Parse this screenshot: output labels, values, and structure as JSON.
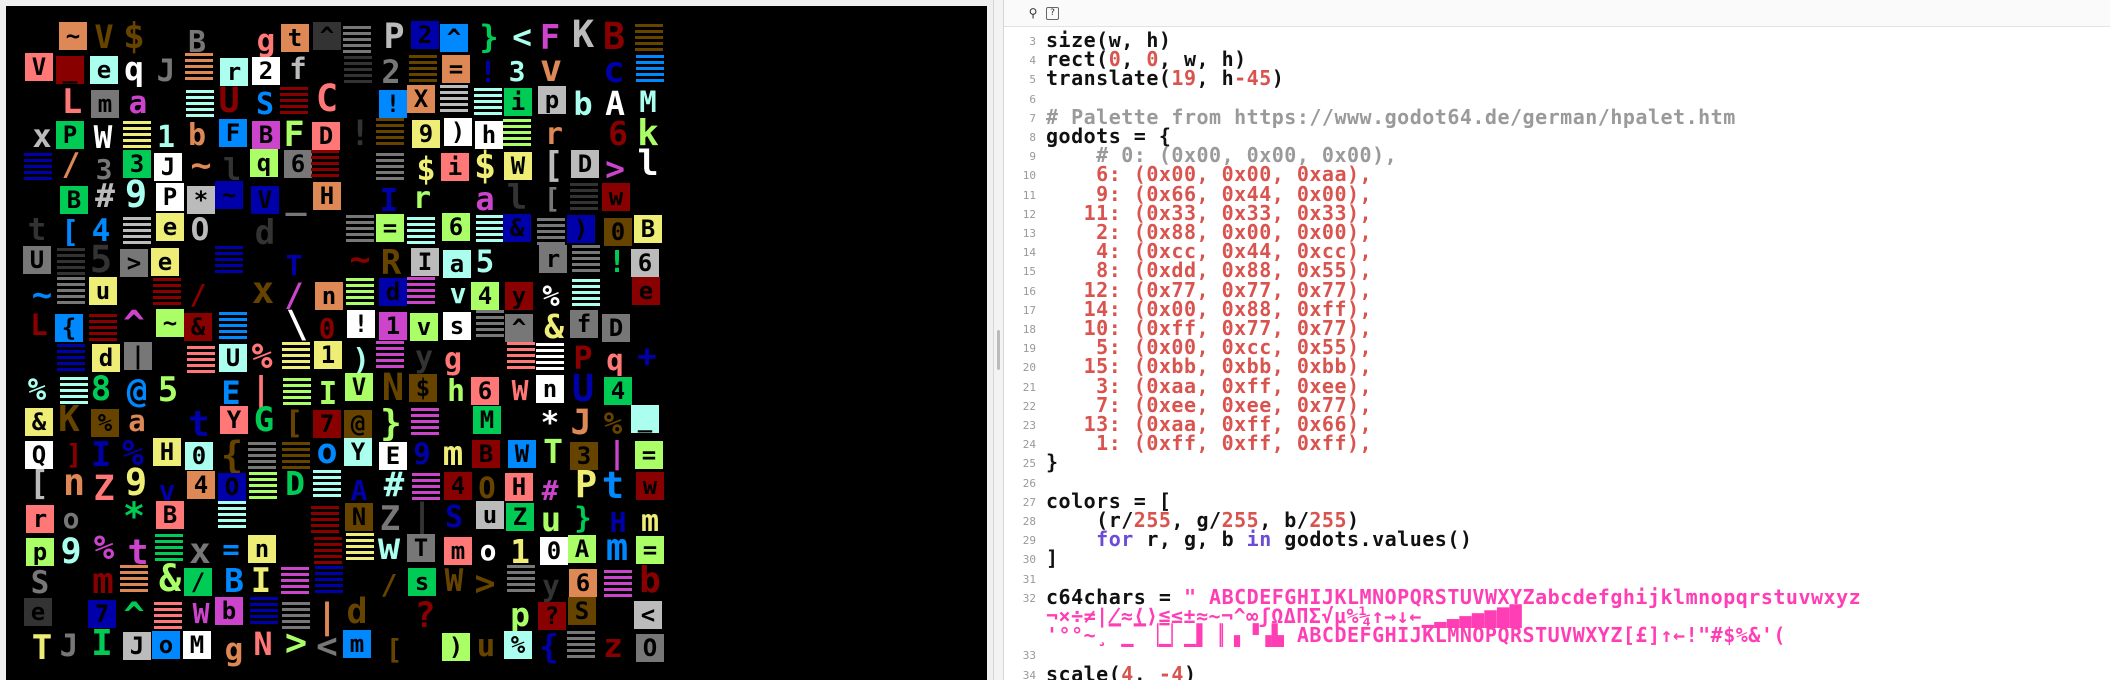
{
  "editor": {
    "toolbar": {
      "zoom_icon": "magnifier-icon",
      "help_icon": "help-icon",
      "help_glyph": "?"
    },
    "lines": [
      {
        "num": "3",
        "segments": [
          {
            "t": "size(w, h)",
            "c": "plain"
          }
        ]
      },
      {
        "num": "4",
        "segments": [
          {
            "t": "rect(",
            "c": "plain"
          },
          {
            "t": "0",
            "c": "num"
          },
          {
            "t": ", ",
            "c": "plain"
          },
          {
            "t": "0",
            "c": "num"
          },
          {
            "t": ", w, h)",
            "c": "plain"
          }
        ]
      },
      {
        "num": "5",
        "segments": [
          {
            "t": "translate(",
            "c": "plain"
          },
          {
            "t": "19",
            "c": "num"
          },
          {
            "t": ", h",
            "c": "plain"
          },
          {
            "t": "-45",
            "c": "num"
          },
          {
            "t": ")",
            "c": "plain"
          }
        ]
      },
      {
        "num": "6",
        "segments": []
      },
      {
        "num": "7",
        "segments": [
          {
            "t": "# Palette from https://www.godot64.de/german/hpalet.htm",
            "c": "comment"
          }
        ]
      },
      {
        "num": "8",
        "segments": [
          {
            "t": "godots = {",
            "c": "plain"
          }
        ]
      },
      {
        "num": "9",
        "segments": [
          {
            "t": "    # 0: (0x00, 0x00, 0x00),",
            "c": "comment"
          }
        ]
      },
      {
        "num": "10",
        "segments": [
          {
            "t": "    6: (0x00, 0x00, 0xaa),",
            "c": "num"
          }
        ]
      },
      {
        "num": "11",
        "segments": [
          {
            "t": "    9: (0x66, 0x44, 0x00),",
            "c": "num"
          }
        ]
      },
      {
        "num": "12",
        "segments": [
          {
            "t": "   11: (0x33, 0x33, 0x33),",
            "c": "num"
          }
        ]
      },
      {
        "num": "13",
        "segments": [
          {
            "t": "    2: (0x88, 0x00, 0x00),",
            "c": "num"
          }
        ]
      },
      {
        "num": "14",
        "segments": [
          {
            "t": "    4: (0xcc, 0x44, 0xcc),",
            "c": "num"
          }
        ]
      },
      {
        "num": "15",
        "segments": [
          {
            "t": "    8: (0xdd, 0x88, 0x55),",
            "c": "num"
          }
        ]
      },
      {
        "num": "16",
        "segments": [
          {
            "t": "   12: (0x77, 0x77, 0x77),",
            "c": "num"
          }
        ]
      },
      {
        "num": "17",
        "segments": [
          {
            "t": "   14: (0x00, 0x88, 0xff),",
            "c": "num"
          }
        ]
      },
      {
        "num": "18",
        "segments": [
          {
            "t": "   10: (0xff, 0x77, 0x77),",
            "c": "num"
          }
        ]
      },
      {
        "num": "19",
        "segments": [
          {
            "t": "    5: (0x00, 0xcc, 0x55),",
            "c": "num"
          }
        ]
      },
      {
        "num": "20",
        "segments": [
          {
            "t": "   15: (0xbb, 0xbb, 0xbb),",
            "c": "num"
          }
        ]
      },
      {
        "num": "21",
        "segments": [
          {
            "t": "    3: (0xaa, 0xff, 0xee),",
            "c": "num"
          }
        ]
      },
      {
        "num": "22",
        "segments": [
          {
            "t": "    7: (0xee, 0xee, 0x77),",
            "c": "num"
          }
        ]
      },
      {
        "num": "23",
        "segments": [
          {
            "t": "   13: (0xaa, 0xff, 0x66),",
            "c": "num"
          }
        ]
      },
      {
        "num": "24",
        "segments": [
          {
            "t": "    1: (0xff, 0xff, 0xff),",
            "c": "num"
          }
        ]
      },
      {
        "num": "25",
        "segments": [
          {
            "t": "}",
            "c": "plain"
          }
        ]
      },
      {
        "num": "26",
        "segments": []
      },
      {
        "num": "27",
        "segments": [
          {
            "t": "colors = [",
            "c": "plain"
          }
        ]
      },
      {
        "num": "28",
        "segments": [
          {
            "t": "    (r/",
            "c": "plain"
          },
          {
            "t": "255",
            "c": "num"
          },
          {
            "t": ", g/",
            "c": "plain"
          },
          {
            "t": "255",
            "c": "num"
          },
          {
            "t": ", b/",
            "c": "plain"
          },
          {
            "t": "255",
            "c": "num"
          },
          {
            "t": ")",
            "c": "plain"
          }
        ]
      },
      {
        "num": "29",
        "segments": [
          {
            "t": "    ",
            "c": "plain"
          },
          {
            "t": "for",
            "c": "kw"
          },
          {
            "t": " r, g, b ",
            "c": "plain"
          },
          {
            "t": "in",
            "c": "kw"
          },
          {
            "t": " godots.values()",
            "c": "plain"
          }
        ]
      },
      {
        "num": "30",
        "segments": [
          {
            "t": "]",
            "c": "plain"
          }
        ]
      },
      {
        "num": "31",
        "segments": []
      },
      {
        "num": "32",
        "segments": [
          {
            "t": "c64chars = ",
            "c": "plain"
          },
          {
            "t": "\" ABCDEFGHIJKLMNOPQRSTUVWXYZabcdefghijklmnopqrstuvwxyz",
            "c": "str"
          }
        ]
      },
      {
        "num": "",
        "segments": [
          {
            "t": "¬×÷≠∤≈⟨⟩≦≤±≈~¬^∞ʃΩΔΠΣ√µ%¼↑→↓←▁▂▃▄▅▆▇█",
            "c": "str"
          }
        ]
      },
      {
        "num": "",
        "segments": [
          {
            "t": "'°°~¸▔▁▔▕▁▏▁▌▕▏▖▝▗▙ ABCDEFGHIJKLMNOPQRSTUVWXYZ[£]↑←!\"#$%&'(",
            "c": "str"
          }
        ]
      },
      {
        "num": "33",
        "segments": []
      },
      {
        "num": "34",
        "segments": [
          {
            "t": "scale(",
            "c": "plain"
          },
          {
            "t": "4",
            "c": "num"
          },
          {
            "t": ", ",
            "c": "plain"
          },
          {
            "t": "-4",
            "c": "num"
          },
          {
            "t": ")",
            "c": "plain"
          }
        ]
      }
    ]
  },
  "palette_hex": [
    "#0000aa",
    "#664400",
    "#333333",
    "#880000",
    "#cc44cc",
    "#dd8855",
    "#777777",
    "#0088ff",
    "#ff7777",
    "#00cc55",
    "#bbbbbb",
    "#aaffee",
    "#eeee77",
    "#aaff66",
    "#ffffff"
  ],
  "glyphs": "ABCDEFGHIJKLMNOPQRSTUVWXYZabcdefghijklmnopqrstuvwxyz0123456789#$%&@?!+=<>/\\|[]{}()*~^_"
}
